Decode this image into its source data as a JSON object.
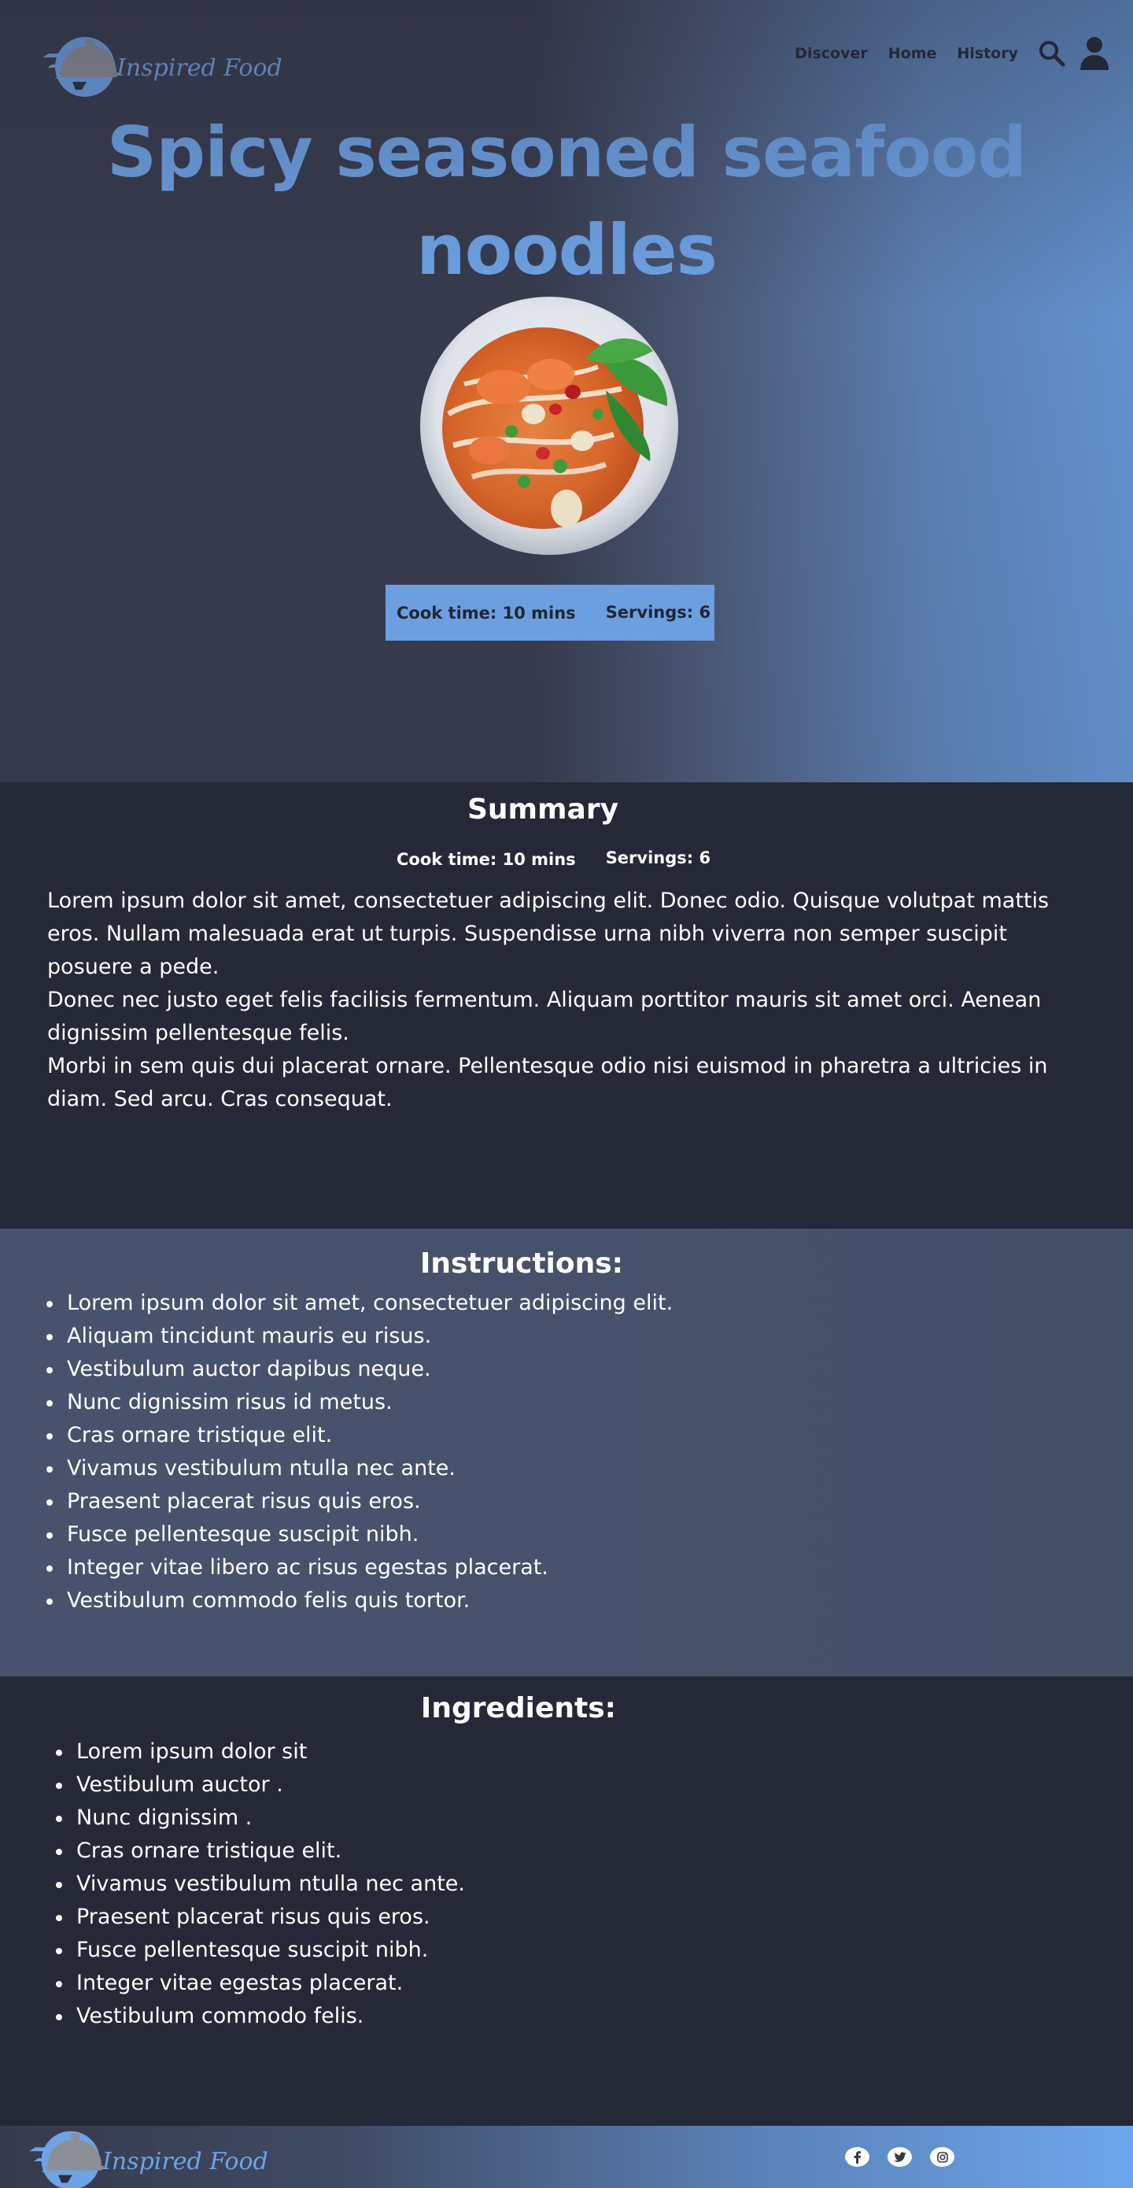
{
  "brand": {
    "name": "Inspired Food"
  },
  "nav": {
    "links": [
      "Discover",
      "Home",
      "History"
    ],
    "search_icon": "search-icon",
    "account_icon": "user-icon"
  },
  "recipe": {
    "title_line1": "Spicy seasoned seafood",
    "title_line2": "noodles",
    "cook_time": "Cook time: 10 mins",
    "servings": "Servings: 6"
  },
  "summary": {
    "heading": "Summary",
    "cook_time": "Cook time: 10 mins",
    "servings": "Servings: 6",
    "paragraphs": [
      "Lorem ipsum dolor sit amet, consectetuer adipiscing elit. Donec odio. Quisque volutpat mattis eros. Nullam malesuada erat ut turpis. Suspendisse urna nibh viverra non semper suscipit posuere a pede.",
      "Donec nec justo eget felis facilisis fermentum. Aliquam porttitor mauris sit amet orci. Aenean dignissim pellentesque felis.",
      "Morbi in sem quis dui placerat ornare. Pellentesque odio nisi euismod in pharetra a ultricies in diam. Sed arcu. Cras consequat."
    ]
  },
  "instructions": {
    "heading": "Instructions:",
    "items": [
      "Lorem ipsum dolor sit amet, consectetuer adipiscing elit.",
      "Aliquam tincidunt mauris eu risus.",
      "Vestibulum auctor dapibus neque.",
      "Nunc dignissim risus id metus.",
      "Cras ornare tristique elit.",
      "Vivamus vestibulum ntulla nec ante.",
      "Praesent placerat risus quis eros.",
      "Fusce pellentesque suscipit nibh.",
      "Integer vitae libero ac risus egestas placerat.",
      "Vestibulum commodo felis quis tortor."
    ]
  },
  "ingredients": {
    "heading": "Ingredients:",
    "items": [
      "Lorem ipsum dolor sit",
      "Vestibulum auctor .",
      "Nunc dignissim .",
      "Cras ornare tristique elit.",
      "Vivamus vestibulum ntulla nec ante.",
      "Praesent placerat risus quis eros.",
      "Fusce pellentesque suscipit nibh.",
      "Integer vitae egestas placerat.",
      "Vestibulum commodo felis."
    ]
  },
  "footer": {
    "brand": "Inspired Food",
    "social_icons": [
      "facebook-icon",
      "twitter-icon",
      "instagram-icon"
    ]
  },
  "colors": {
    "accent": "#6ea3e6",
    "dark": "#252837",
    "mid": "#48526d",
    "nav_text": "#222633"
  }
}
